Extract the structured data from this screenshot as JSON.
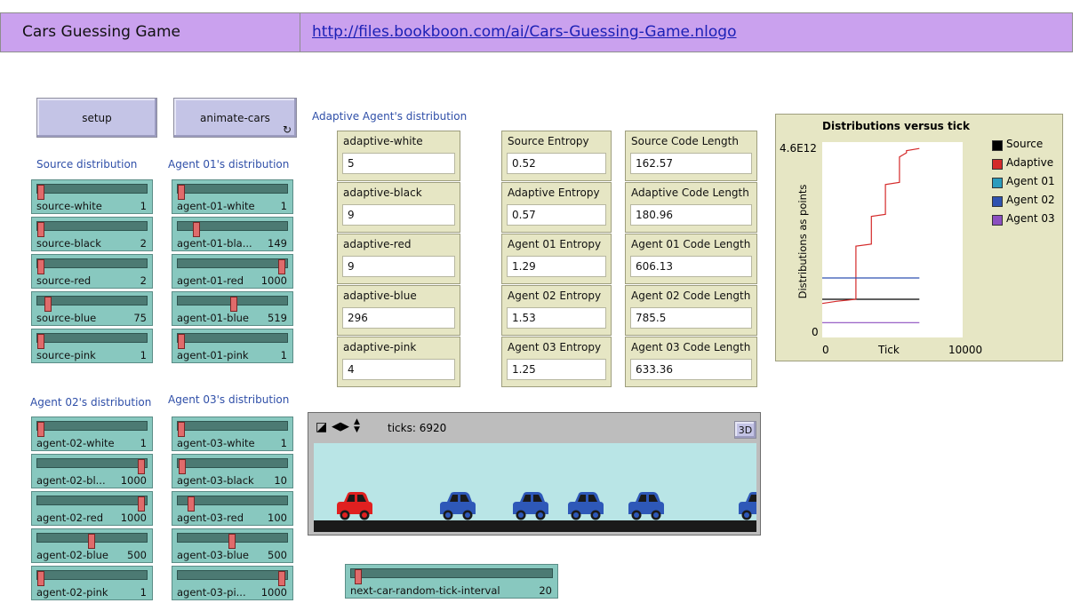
{
  "header": {
    "title": "Cars Guessing Game",
    "link": "http://files.bookboon.com/ai/Cars-Guessing-Game.nlogo"
  },
  "buttons": {
    "setup": "setup",
    "animate": "animate-cars",
    "forever_icon": "forever-icon"
  },
  "sections": {
    "source": "Source distribution",
    "agent01": "Agent 01's distribution",
    "agent02": "Agent 02's distribution",
    "agent03": "Agent 03's distribution",
    "adaptive": "Adaptive Agent's distribution"
  },
  "sliders": {
    "source": [
      {
        "label": "source-white",
        "value": "1",
        "fraction": 0.0
      },
      {
        "label": "source-black",
        "value": "2",
        "fraction": 0.0
      },
      {
        "label": "source-red",
        "value": "2",
        "fraction": 0.0
      },
      {
        "label": "source-blue",
        "value": "75",
        "fraction": 0.07
      },
      {
        "label": "source-pink",
        "value": "1",
        "fraction": 0.0
      }
    ],
    "agent01": [
      {
        "label": "agent-01-white",
        "value": "1",
        "fraction": 0.0
      },
      {
        "label": "agent-01-bla...",
        "value": "149",
        "fraction": 0.15
      },
      {
        "label": "agent-01-red",
        "value": "1000",
        "fraction": 1.0
      },
      {
        "label": "agent-01-blue",
        "value": "519",
        "fraction": 0.52
      },
      {
        "label": "agent-01-pink",
        "value": "1",
        "fraction": 0.0
      }
    ],
    "agent02": [
      {
        "label": "agent-02-white",
        "value": "1",
        "fraction": 0.0
      },
      {
        "label": "agent-02-bl...",
        "value": "1000",
        "fraction": 1.0
      },
      {
        "label": "agent-02-red",
        "value": "1000",
        "fraction": 1.0
      },
      {
        "label": "agent-02-blue",
        "value": "500",
        "fraction": 0.5
      },
      {
        "label": "agent-02-pink",
        "value": "1",
        "fraction": 0.0
      }
    ],
    "agent03": [
      {
        "label": "agent-03-white",
        "value": "1",
        "fraction": 0.0
      },
      {
        "label": "agent-03-black",
        "value": "10",
        "fraction": 0.01
      },
      {
        "label": "agent-03-red",
        "value": "100",
        "fraction": 0.1
      },
      {
        "label": "agent-03-blue",
        "value": "500",
        "fraction": 0.5
      },
      {
        "label": "agent-03-pi...",
        "value": "1000",
        "fraction": 1.0
      }
    ],
    "next_car": {
      "label": "next-car-random-tick-interval",
      "value": "20",
      "fraction": 0.02
    }
  },
  "adaptive_inputs": [
    {
      "label": "adaptive-white",
      "value": "5"
    },
    {
      "label": "adaptive-black",
      "value": "9"
    },
    {
      "label": "adaptive-red",
      "value": "9"
    },
    {
      "label": "adaptive-blue",
      "value": "296"
    },
    {
      "label": "adaptive-pink",
      "value": "4"
    }
  ],
  "entropies": [
    {
      "label": "Source Entropy",
      "value": "0.52"
    },
    {
      "label": "Adaptive Entropy",
      "value": "0.57"
    },
    {
      "label": "Agent 01 Entropy",
      "value": "1.29"
    },
    {
      "label": "Agent 02 Entropy",
      "value": "1.53"
    },
    {
      "label": "Agent 03 Entropy",
      "value": "1.25"
    }
  ],
  "code_lengths": [
    {
      "label": "Source Code Length",
      "value": "162.57"
    },
    {
      "label": "Adaptive Code Length",
      "value": "180.96"
    },
    {
      "label": "Agent 01 Code Length",
      "value": "606.13"
    },
    {
      "label": "Agent 02 Code Length",
      "value": "785.5"
    },
    {
      "label": "Agent 03 Code Length",
      "value": "633.36"
    }
  ],
  "view": {
    "ticks_label": "ticks: 6920",
    "btn_3d": "3D",
    "sky_color": "#b9e5e6",
    "ground_color": "#1a1a1a",
    "cars": [
      {
        "color": "#e02020"
      },
      {
        "color": "#2e58b8"
      },
      {
        "color": "#2e58b8"
      },
      {
        "color": "#2e58b8"
      },
      {
        "color": "#2e58b8"
      },
      {
        "color": "#2e58b8"
      }
    ]
  },
  "plot": {
    "title": "Distributions versus tick",
    "ymax_label": "4.6E12",
    "ymin_label": "0",
    "xmin_label": "0",
    "xmax_label": "10000",
    "xlabel": "Tick",
    "ylabel": "Distributions as points",
    "legend": [
      {
        "name": "Source",
        "color": "#000000"
      },
      {
        "name": "Adaptive",
        "color": "#d42a2a"
      },
      {
        "name": "Agent 01",
        "color": "#2b9bbd"
      },
      {
        "name": "Agent 02",
        "color": "#2f52b0"
      },
      {
        "name": "Agent 03",
        "color": "#8b4fc0"
      }
    ]
  },
  "chart_data": {
    "type": "line",
    "title": "Distributions versus tick",
    "xlabel": "Tick",
    "ylabel": "Distributions as points",
    "xlim": [
      0,
      10000
    ],
    "ylim": [
      0,
      4600000000000.0
    ],
    "series": [
      {
        "name": "Source",
        "x": [
          0,
          6920
        ],
        "y": [
          900000000000.0,
          900000000000.0
        ]
      },
      {
        "name": "Adaptive",
        "x": [
          0,
          1000,
          1000,
          2400,
          2400,
          3500,
          3500,
          4500,
          4500,
          5500,
          5500,
          6000,
          6000,
          6920
        ],
        "y": [
          800000000000.0,
          850000000000.0,
          850000000000.0,
          900000000000.0,
          2150000000000.0,
          2200000000000.0,
          2850000000000.0,
          2900000000000.0,
          3600000000000.0,
          3650000000000.0,
          4250000000000.0,
          4350000000000.0,
          4400000000000.0,
          4450000000000.0
        ]
      },
      {
        "name": "Agent 02",
        "x": [
          0,
          6920
        ],
        "y": [
          1400000000000.0,
          1400000000000.0
        ]
      },
      {
        "name": "Agent 03",
        "x": [
          0,
          6920
        ],
        "y": [
          350000000000.0,
          350000000000.0
        ]
      }
    ]
  }
}
